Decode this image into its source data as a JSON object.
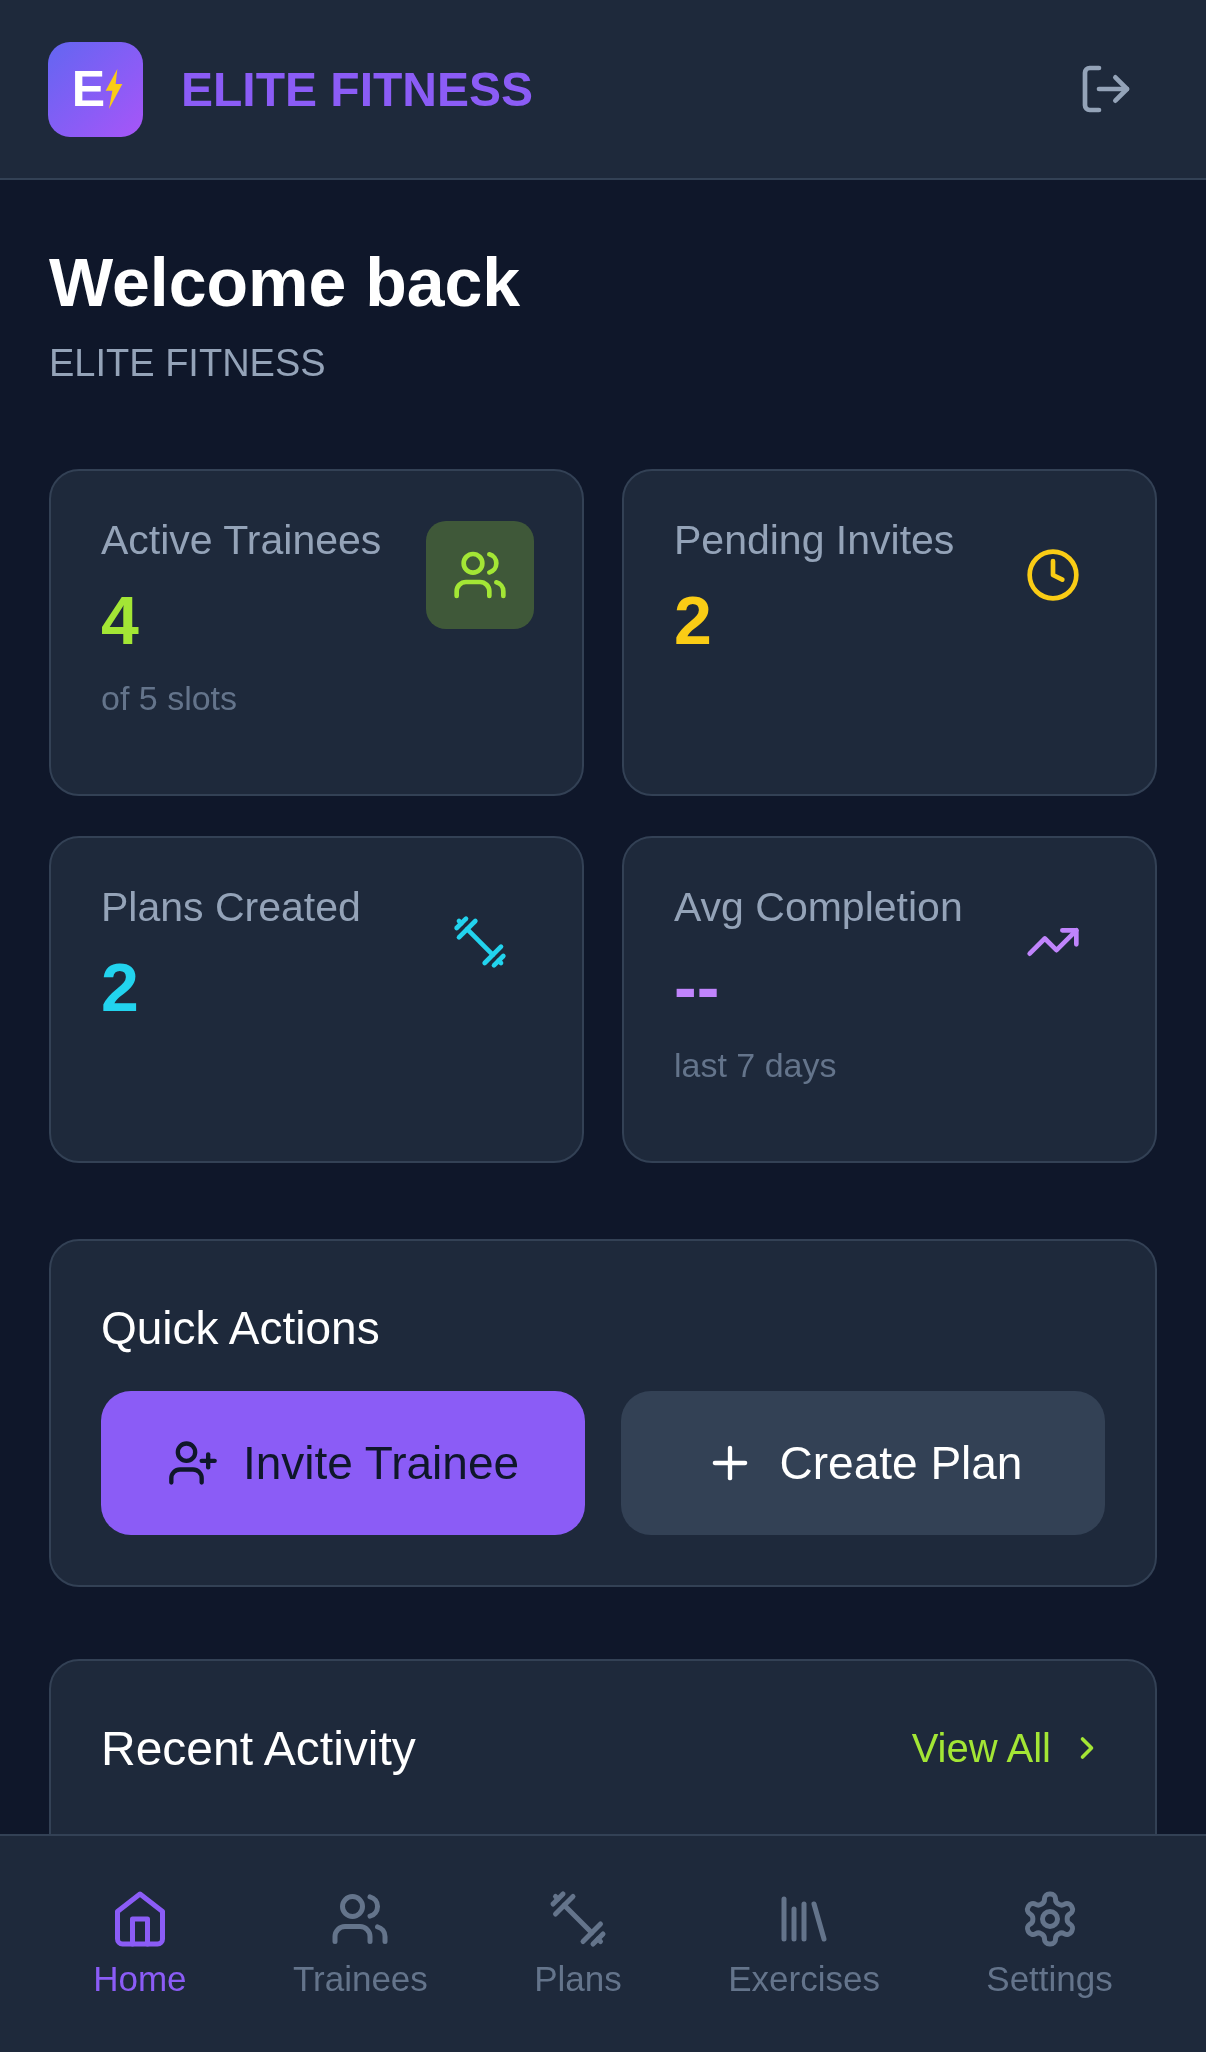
{
  "header": {
    "logo_letter": "E",
    "title": "ELITE FITNESS"
  },
  "welcome": {
    "title": "Welcome back",
    "subtitle": "ELITE FITNESS"
  },
  "stats": [
    {
      "label": "Active Trainees",
      "value": "4",
      "note": "of 5 slots",
      "color": "#a3e635",
      "icon_boxed": true
    },
    {
      "label": "Pending Invites",
      "value": "2",
      "color": "#facc15",
      "icon_boxed": false
    },
    {
      "label": "Plans Created",
      "value": "2",
      "color": "#22d3ee",
      "icon_boxed": false
    },
    {
      "label": "Avg Completion",
      "value": "--",
      "note": "last 7 days",
      "color": "#c084fc",
      "icon_boxed": false
    }
  ],
  "quick_actions": {
    "title": "Quick Actions",
    "buttons": [
      {
        "label": "Invite Trainee",
        "kind": "primary"
      },
      {
        "label": "Create Plan",
        "kind": "secondary"
      }
    ]
  },
  "recent_activity": {
    "title": "Recent Activity",
    "link": "View All"
  },
  "nav": [
    {
      "label": "Home",
      "selected": true
    },
    {
      "label": "Trainees",
      "selected": false
    },
    {
      "label": "Plans",
      "selected": false
    },
    {
      "label": "Exercises",
      "selected": false
    },
    {
      "label": "Settings",
      "selected": false
    }
  ]
}
